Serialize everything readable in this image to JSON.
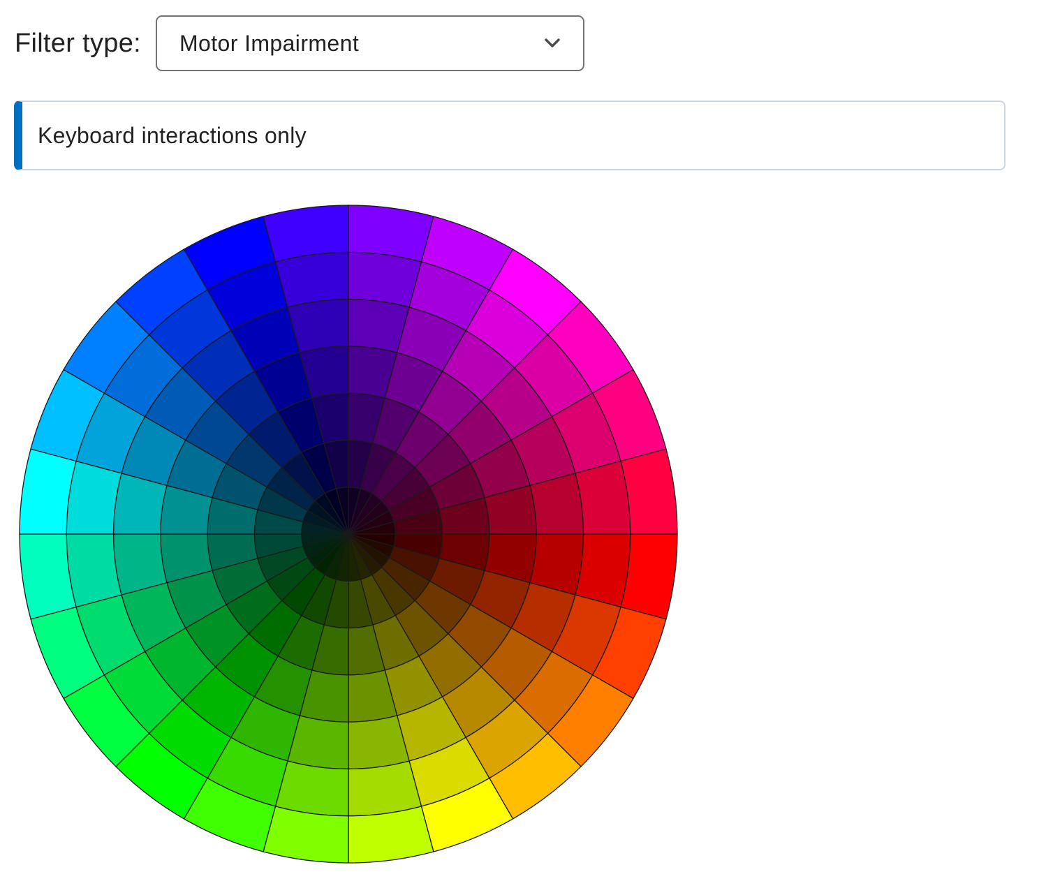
{
  "filter": {
    "label": "Filter type:",
    "selected": "Motor Impairment",
    "chevron_icon": "chevron-down-icon"
  },
  "alert": {
    "text": "Keyboard interactions only",
    "accent_color": "#006fbf"
  },
  "color_wheel": {
    "segments": 24,
    "rings": 7,
    "start_hue_degrees": 0,
    "direction": "clockwise from east"
  }
}
